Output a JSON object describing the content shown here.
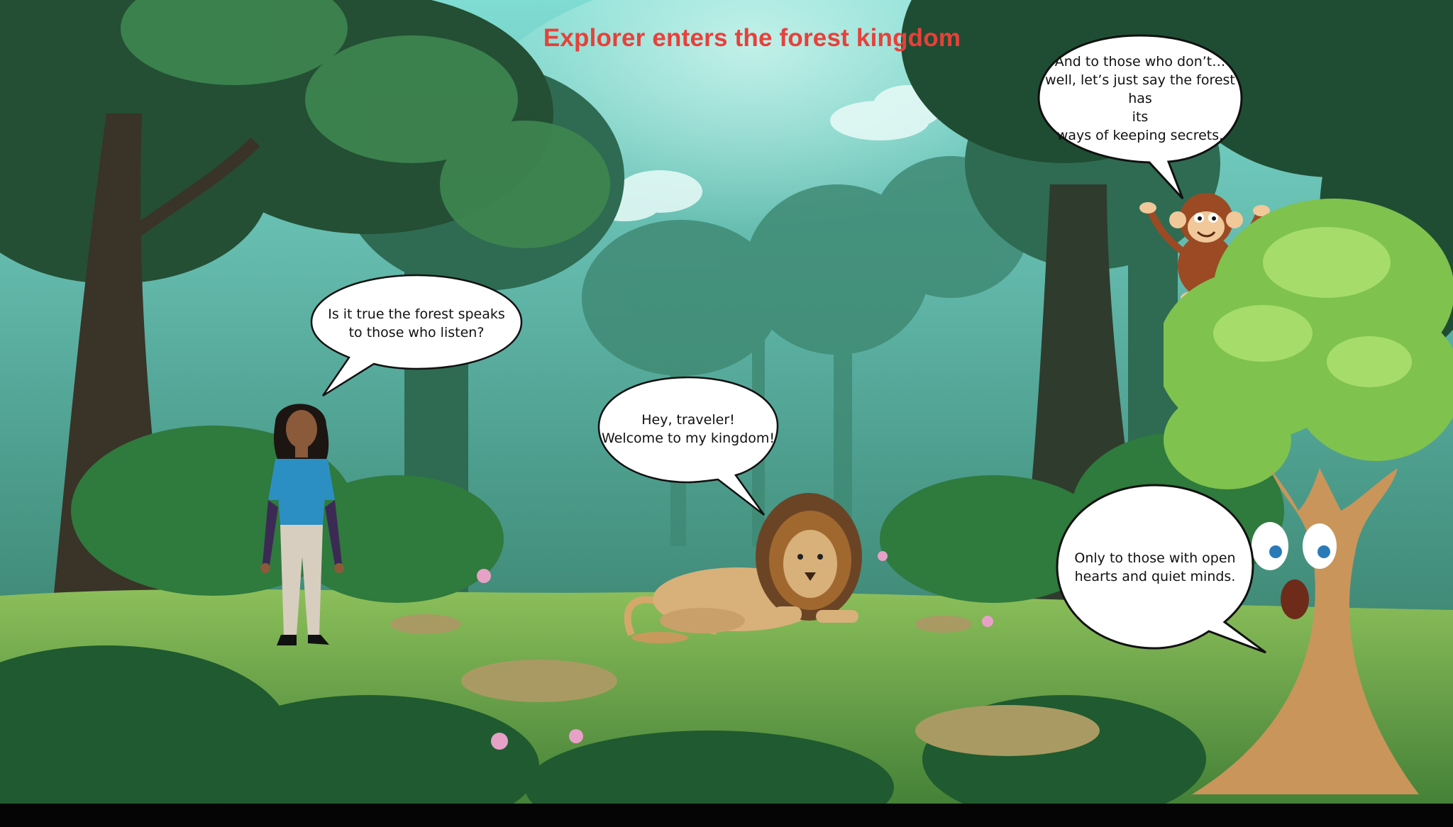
{
  "scene": {
    "title": "Explorer enters the forest kingdom",
    "title_color": "#e8403a",
    "sky_color": "#8fd8cf",
    "canopy_dark": "#1f4a2e",
    "canopy_light": "#5fa46a",
    "grass_color": "#6eaa48"
  },
  "characters": {
    "explorer": {
      "icon": "woman-explorer-icon"
    },
    "lion": {
      "icon": "lion-icon"
    },
    "monkey": {
      "icon": "monkey-icon"
    },
    "tree": {
      "icon": "talking-tree-icon"
    }
  },
  "dialogue": {
    "explorer": "Is it true the forest speaks\nto those who listen?",
    "lion": "Hey, traveler!\nWelcome to my kingdom!",
    "monkey": "And to those who don’t…\nwell, let’s just say the forest has\nits\nways of keeping secrets.",
    "tree": "Only to those with open\nhearts and quiet minds."
  }
}
